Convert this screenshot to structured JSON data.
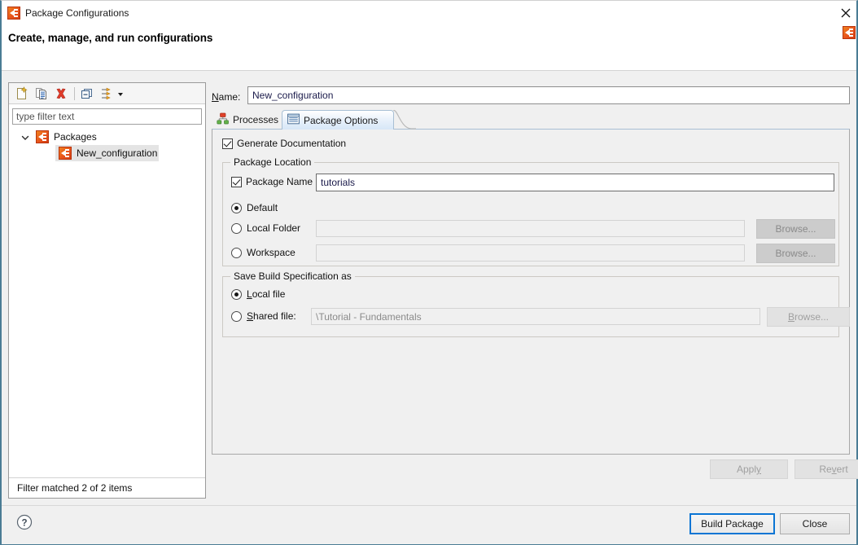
{
  "window": {
    "title": "Package Configurations",
    "title_icon": "app-icon",
    "close_icon": "close-icon",
    "corner_icon": "app-icon",
    "headline": "Create, manage, and run configurations"
  },
  "left_panel": {
    "toolbar": [
      {
        "name": "new-configuration-icon",
        "tooltip": "New"
      },
      {
        "name": "duplicate-configuration-icon",
        "tooltip": "Duplicate"
      },
      {
        "name": "delete-configuration-icon",
        "tooltip": "Delete"
      },
      {
        "name": "collapse-all-icon",
        "tooltip": "Collapse All"
      },
      {
        "name": "filter-configurations-icon",
        "tooltip": "Filter"
      },
      {
        "name": "chevron-down-icon",
        "tooltip": "Menu"
      }
    ],
    "filter": {
      "value": "",
      "placeholder": "type filter text"
    },
    "tree": {
      "root": {
        "label": "Packages",
        "expanded": true,
        "icon": "package-icon",
        "children": [
          {
            "label": "New_configuration",
            "icon": "package-icon",
            "selected": true
          }
        ]
      }
    },
    "status": "Filter matched 2 of 2 items"
  },
  "right_panel": {
    "name_label": "Name:",
    "name_mnemonic": "N",
    "name_value": "New_configuration",
    "tabs": [
      {
        "id": "processes",
        "label": "Processes",
        "icon": "hierarchy-icon",
        "active": false
      },
      {
        "id": "package_options",
        "label": "Package Options",
        "icon": "table-icon",
        "active": true
      }
    ],
    "generate_documentation": {
      "label": "Generate Documentation",
      "checked": true
    },
    "package_location": {
      "title": "Package Location",
      "package_name": {
        "label": "Package Name",
        "checked": true,
        "value": "tutorials",
        "enabled": true
      },
      "options": [
        {
          "id": "default",
          "label": "Default",
          "selected": true,
          "has_field": false,
          "field_value": "",
          "field_enabled": false,
          "browse": null
        },
        {
          "id": "local_folder",
          "label": "Local Folder",
          "selected": false,
          "has_field": true,
          "field_value": "",
          "field_enabled": false,
          "browse": {
            "label": "Browse...",
            "enabled": false
          }
        },
        {
          "id": "workspace",
          "label": "Workspace",
          "selected": false,
          "has_field": true,
          "field_value": "",
          "field_enabled": false,
          "browse": {
            "label": "Browse...",
            "enabled": false
          }
        }
      ]
    },
    "save_build_spec": {
      "title": "Save Build Specification as",
      "options": [
        {
          "id": "local_file",
          "label": "Local file",
          "mnemonic": "L",
          "selected": true,
          "has_field": false,
          "field_value": "",
          "browse": null
        },
        {
          "id": "shared_file",
          "label": "Shared file:",
          "mnemonic": "S",
          "selected": false,
          "has_field": true,
          "field_value": "\\Tutorial - Fundamentals",
          "field_enabled": false,
          "browse": {
            "label": "Browse...",
            "mnemonic": "B",
            "enabled": false
          }
        }
      ]
    },
    "apply_button": {
      "label": "Apply",
      "mnemonic": "y",
      "enabled": false
    },
    "revert_button": {
      "label": "Revert",
      "mnemonic": "v",
      "enabled": false
    }
  },
  "footer": {
    "help_icon": "help-icon",
    "build_button": {
      "label": "Build Package",
      "focused": true
    },
    "close_button": {
      "label": "Close",
      "focused": false
    }
  },
  "colors": {
    "accent_orange": "#e8541c",
    "focus_blue": "#0a75d4",
    "tab_active": "#d7e7f7",
    "panel_bg": "#f0f0f0",
    "border": "#a8a8a8",
    "frame_blue": "#4a7c94"
  }
}
